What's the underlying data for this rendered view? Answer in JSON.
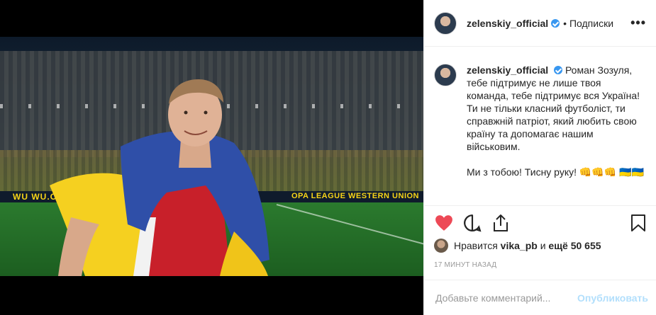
{
  "post": {
    "username": "zelenskiy_official",
    "follow_label": "• Подписки",
    "more_label": "•••"
  },
  "media": {
    "ad_left": "WU  WU.COM",
    "ad_right": "OPA LEAGUE  WESTERN UNION"
  },
  "caption": {
    "username": "zelenskiy_official",
    "line1": "Роман Зозуля, тебе підтримує не лише твоя команда, тебе підтримує вся Україна!",
    "line2": "Ти не тільки класний футболіст, ти справжній патріот, який любить свою країну та допомагає нашим військовим.",
    "line3": "Ми з тобою! Тисну руку! 👊👊👊 🇺🇦🇺🇦"
  },
  "actions": {
    "like_icon": "heart-icon",
    "comment_icon": "comment-icon",
    "share_icon": "share-icon",
    "save_icon": "bookmark-icon",
    "like_color": "#ed4956"
  },
  "likes": {
    "prefix": "Нравится",
    "user": "vika_pb",
    "middle": "и",
    "rest": "ещё 50 655"
  },
  "time": "17 МИНУТ НАЗАД",
  "comment_box": {
    "placeholder": "Добавьте комментарий...",
    "publish_label": "Опубликовать"
  }
}
